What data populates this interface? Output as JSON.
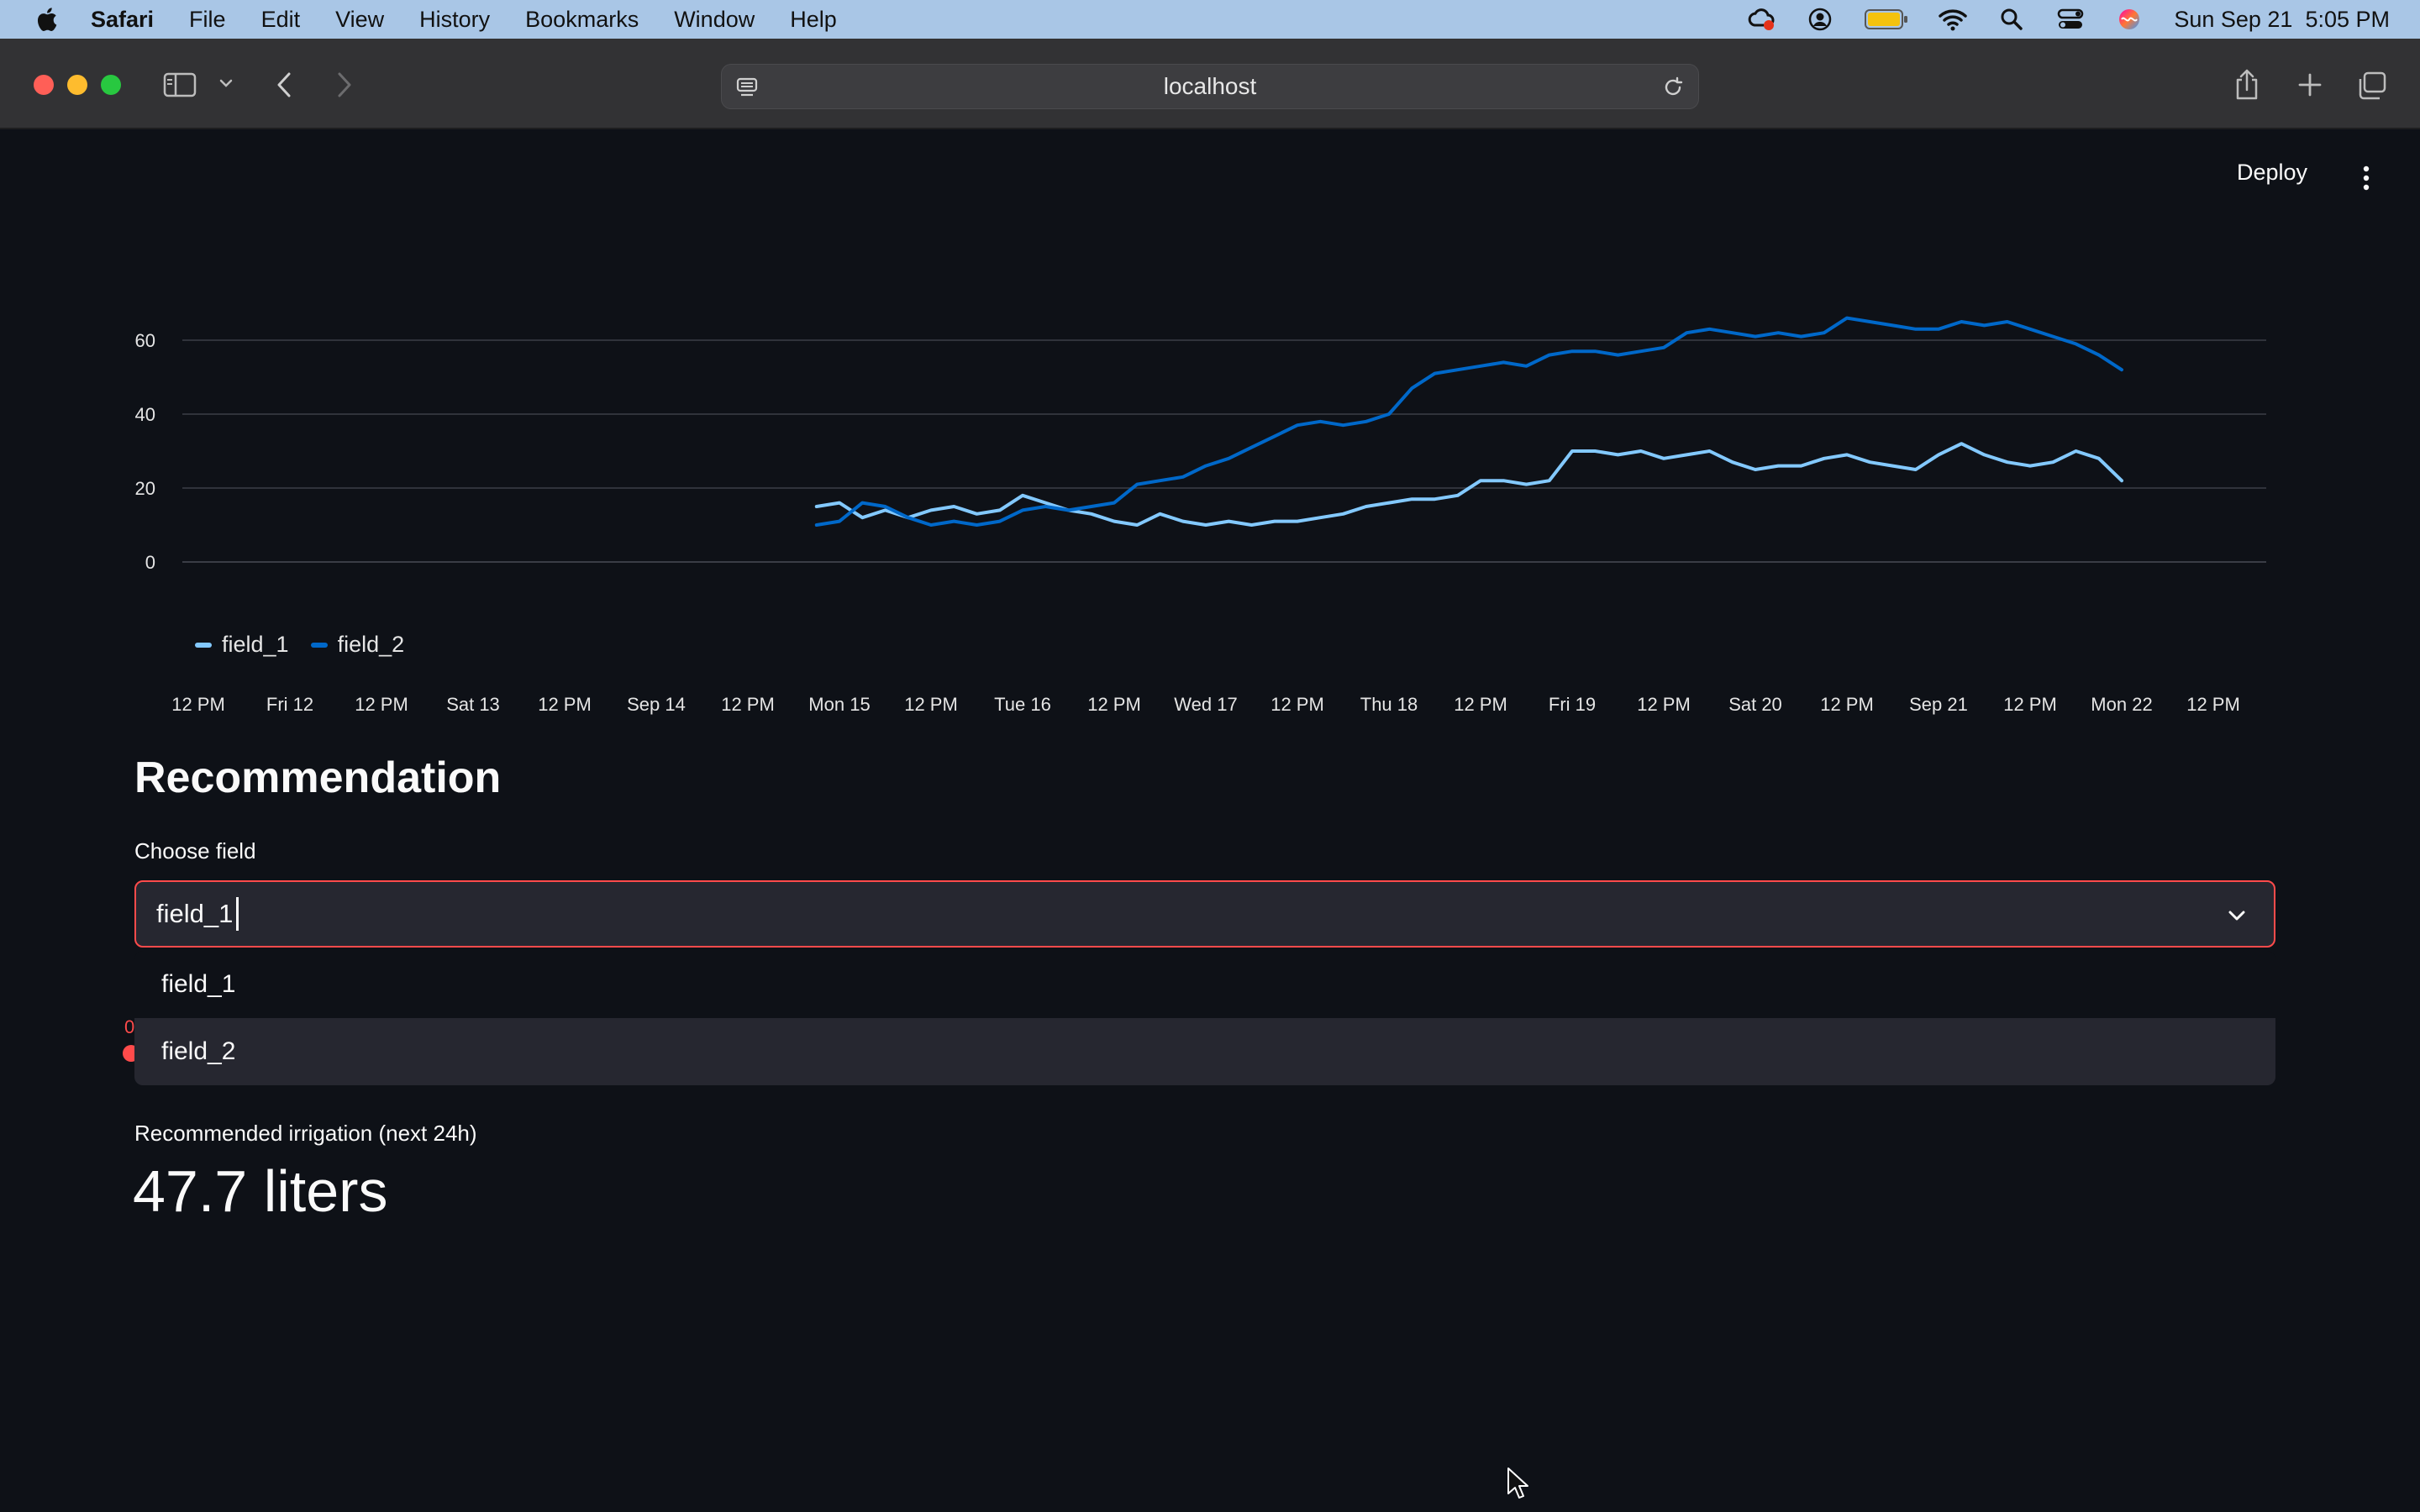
{
  "menubar": {
    "app_name": "Safari",
    "menus": [
      "File",
      "Edit",
      "View",
      "History",
      "Bookmarks",
      "Window",
      "Help"
    ],
    "clock": "Sun Sep 21  5:05 PM"
  },
  "browser": {
    "url": "localhost"
  },
  "app_header": {
    "deploy_label": "Deploy"
  },
  "chart_data": {
    "type": "line",
    "x_tick_labels": [
      "12 PM",
      "Fri 12",
      "12 PM",
      "Sat 13",
      "12 PM",
      "Sep 14",
      "12 PM",
      "Mon 15",
      "12 PM",
      "Tue 16",
      "12 PM",
      "Wed 17",
      "12 PM",
      "Thu 18",
      "12 PM",
      "Fri 19",
      "12 PM",
      "Sat 20",
      "12 PM",
      "Sep 21",
      "12 PM",
      "Mon 22",
      "12 PM"
    ],
    "y_ticks": [
      0,
      20,
      40,
      60
    ],
    "ylim": [
      0,
      64
    ],
    "grid": true,
    "legend_position": "bottom-left",
    "x_unit": "hours since Thu 11 00:00",
    "series": [
      {
        "name": "field_1",
        "color": "#83c9ff",
        "x": [
          93,
          96,
          99,
          102,
          105,
          108,
          111,
          114,
          117,
          120,
          123,
          126,
          129,
          132,
          135,
          138,
          141,
          144,
          147,
          150,
          153,
          156,
          159,
          162,
          165,
          168,
          171,
          174,
          177,
          180,
          183,
          186,
          189,
          192,
          195,
          198,
          201,
          204,
          207,
          210,
          213,
          216,
          219,
          222,
          225,
          228,
          231,
          234,
          237,
          240,
          243,
          246,
          249,
          252,
          255,
          258,
          261,
          264
        ],
        "y": [
          15,
          16,
          12,
          14,
          12,
          14,
          15,
          13,
          14,
          18,
          16,
          14,
          13,
          11,
          10,
          13,
          11,
          10,
          11,
          10,
          11,
          11,
          12,
          13,
          15,
          16,
          17,
          17,
          18,
          22,
          22,
          21,
          22,
          30,
          30,
          29,
          30,
          28,
          29,
          30,
          27,
          25,
          26,
          26,
          28,
          29,
          27,
          26,
          25,
          29,
          32,
          29,
          27,
          26,
          27,
          30,
          28,
          22
        ]
      },
      {
        "name": "field_2",
        "color": "#0068c9",
        "x": [
          93,
          96,
          99,
          102,
          105,
          108,
          111,
          114,
          117,
          120,
          123,
          126,
          129,
          132,
          135,
          138,
          141,
          144,
          147,
          150,
          153,
          156,
          159,
          162,
          165,
          168,
          171,
          174,
          177,
          180,
          183,
          186,
          189,
          192,
          195,
          198,
          201,
          204,
          207,
          210,
          213,
          216,
          219,
          222,
          225,
          228,
          231,
          234,
          237,
          240,
          243,
          246,
          249,
          252,
          255,
          258,
          261,
          264
        ],
        "y": [
          10,
          11,
          16,
          15,
          12,
          10,
          11,
          10,
          11,
          14,
          15,
          14,
          15,
          16,
          21,
          22,
          23,
          26,
          28,
          31,
          34,
          37,
          38,
          37,
          38,
          40,
          47,
          51,
          52,
          53,
          54,
          53,
          56,
          57,
          57,
          56,
          57,
          58,
          62,
          63,
          62,
          61,
          62,
          61,
          62,
          66,
          65,
          64,
          63,
          63,
          65,
          64,
          65,
          63,
          61,
          59,
          56,
          52
        ]
      }
    ]
  },
  "recommendation": {
    "heading": "Recommendation",
    "select_label": "Choose field",
    "select_value": "field_1",
    "options": [
      "field_1",
      "field_2"
    ],
    "hidden_peek_text": "0",
    "metric_label": "Recommended irrigation (next 24h)",
    "metric_value": "47.7 liters"
  }
}
